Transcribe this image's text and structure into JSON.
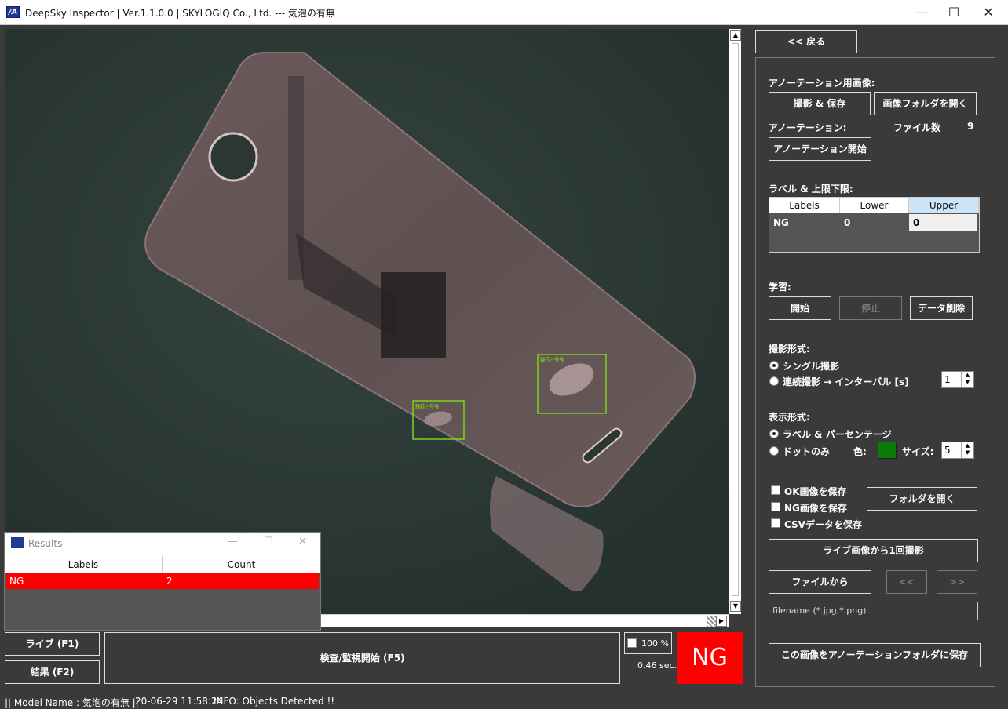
{
  "window": {
    "title": "DeepSky Inspector | Ver.1.1.0.0 | SKYLOGIQ Co., Ltd. --- 気泡の有無",
    "min_icon": "minimize-icon",
    "max_icon": "maximize-icon",
    "close_icon": "close-icon"
  },
  "viewer": {
    "detections": [
      {
        "label": "NG:99"
      },
      {
        "label": "NG:99"
      }
    ]
  },
  "results": {
    "title": "Results",
    "columns": [
      "Labels",
      "Count"
    ],
    "rows": [
      {
        "label": "NG",
        "count": "2"
      }
    ]
  },
  "bottom": {
    "live_button": "ライブ (F1)",
    "results_button": "結果 (F2)",
    "inspect_button": "検査/監視開始 (F5)",
    "zoom_label": "100 %",
    "time_label": "0.46 sec.",
    "verdict": "NG"
  },
  "panel": {
    "back_button": "<< 戻る",
    "annotation_image_heading": "アノーテーション用画像:",
    "capture_save_button": "撮影 & 保存",
    "open_image_folder_button": "画像フォルダを開く",
    "annotation_heading": "アノーテーション:",
    "file_count_label": "ファイル数",
    "file_count_value": "9",
    "annotation_start_button": "アノーテーション開始",
    "label_limits_heading": "ラベル & 上限下限:",
    "grid": {
      "columns": [
        "Labels",
        "Lower",
        "Upper"
      ],
      "rows": [
        {
          "label": "NG",
          "lower": "0",
          "upper": "0"
        }
      ]
    },
    "training_heading": "学習:",
    "start_button": "開始",
    "stop_button": "停止",
    "delete_data_button": "データ削除",
    "capture_mode_heading": "撮影形式:",
    "single_capture": "シングル撮影",
    "continuous_capture": "連続撮影 → インターバル [s]",
    "interval_value": "1",
    "display_mode_heading": "表示形式:",
    "label_percentage": "ラベル & パーセンテージ",
    "dot_only": "ドットのみ",
    "color_label": "色:",
    "dot_color": "#0a7a0a",
    "size_label": "サイズ:",
    "size_value": "5",
    "save_ok": "OK画像を保存",
    "save_ng": "NG画像を保存",
    "save_csv": "CSVデータを保存",
    "open_folder_button": "フォルダを開く",
    "live_capture_button": "ライブ画像から1回撮影",
    "from_file_button": "ファイルから",
    "prev_button": "<<",
    "next_button": ">>",
    "filename_placeholder": "filename (*.jpg,*.png)",
    "save_to_annotation_button": "この画像をアノーテーションフォルダに保存"
  },
  "status": {
    "model_name": "|| Model Name : 気泡の有無 ||",
    "timestamp": "20-06-29 11:58:24",
    "info": "INFO:   Objects Detected !!"
  },
  "colors": {
    "verdict_bg": "#ff0000",
    "detection_box": "#7fd11a"
  }
}
